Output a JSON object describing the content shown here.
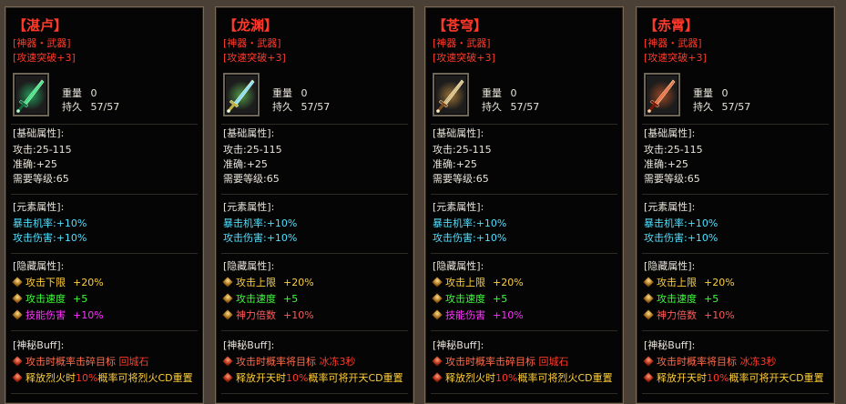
{
  "panels": [
    {
      "name": "湛卢",
      "type_line": "[神器・武器]",
      "effect_line": "[攻速突破+3]",
      "weight_label": "重量",
      "weight_value": "0",
      "durability_label": "持久",
      "durability_value": "57/57",
      "base_title": "[基础属性]:",
      "base_lines": [
        "攻击:25-115",
        "准确:+25",
        "需要等级:65"
      ],
      "elem_title": "[元素属性]:",
      "elem_lines": [
        "暴击机率:+10%",
        "攻击伤害:+10%"
      ],
      "hidden_title": "[隐藏属性]:",
      "hidden": [
        {
          "label": "攻击下限",
          "value": "+20%",
          "label_color": "orange",
          "value_color": "orange"
        },
        {
          "label": "攻击速度",
          "value": "+5",
          "label_color": "green",
          "value_color": "green"
        },
        {
          "label": "技能伤害",
          "value": "+10%",
          "label_color": "magenta",
          "value_color": "magenta"
        }
      ],
      "buff_title": "[神秘Buff]:",
      "buff1": {
        "text": "攻击时概率击碎目标",
        "value": "回城石"
      },
      "buff2": {
        "pre": "释放烈火时",
        "pct": "10%",
        "post": "概率可将烈火CD重置"
      }
    },
    {
      "name": "龙渊",
      "type_line": "[神器・武器]",
      "effect_line": "[攻速突破+3]",
      "weight_label": "重量",
      "weight_value": "0",
      "durability_label": "持久",
      "durability_value": "57/57",
      "base_title": "[基础属性]:",
      "base_lines": [
        "攻击:25-115",
        "准确:+25",
        "需要等级:65"
      ],
      "elem_title": "[元素属性]:",
      "elem_lines": [
        "暴击机率:+10%",
        "攻击伤害:+10%"
      ],
      "hidden_title": "[隐藏属性]:",
      "hidden": [
        {
          "label": "攻击上限",
          "value": "+20%",
          "label_color": "orange",
          "value_color": "orange"
        },
        {
          "label": "攻击速度",
          "value": "+5",
          "label_color": "green",
          "value_color": "green"
        },
        {
          "label": "神力倍数",
          "value": "+10%",
          "label_color": "pink",
          "value_color": "pink"
        }
      ],
      "buff_title": "[神秘Buff]:",
      "buff1": {
        "text": "攻击时概率将目标",
        "value": "冰冻3秒"
      },
      "buff2": {
        "pre": "释放开天时",
        "pct": "10%",
        "post": "概率可将开天CD重置"
      }
    },
    {
      "name": "苍穹",
      "type_line": "[神器・武器]",
      "effect_line": "[攻速突破+3]",
      "weight_label": "重量",
      "weight_value": "0",
      "durability_label": "持久",
      "durability_value": "57/57",
      "base_title": "[基础属性]:",
      "base_lines": [
        "攻击:25-115",
        "准确:+25",
        "需要等级:65"
      ],
      "elem_title": "[元素属性]:",
      "elem_lines": [
        "暴击机率:+10%",
        "攻击伤害:+10%"
      ],
      "hidden_title": "[隐藏属性]:",
      "hidden": [
        {
          "label": "攻击上限",
          "value": "+20%",
          "label_color": "orange",
          "value_color": "orange"
        },
        {
          "label": "攻击速度",
          "value": "+5",
          "label_color": "green",
          "value_color": "green"
        },
        {
          "label": "技能伤害",
          "value": "+10%",
          "label_color": "magenta",
          "value_color": "magenta"
        }
      ],
      "buff_title": "[神秘Buff]:",
      "buff1": {
        "text": "攻击时概率击碎目标",
        "value": "回城石"
      },
      "buff2": {
        "pre": "释放烈火时",
        "pct": "10%",
        "post": "概率可将烈火CD重置"
      }
    },
    {
      "name": "赤霄",
      "type_line": "[神器・武器]",
      "effect_line": "[攻速突破+3]",
      "weight_label": "重量",
      "weight_value": "0",
      "durability_label": "持久",
      "durability_value": "57/57",
      "base_title": "[基础属性]:",
      "base_lines": [
        "攻击:25-115",
        "准确:+25",
        "需要等级:65"
      ],
      "elem_title": "[元素属性]:",
      "elem_lines": [
        "暴击机率:+10%",
        "攻击伤害:+10%"
      ],
      "hidden_title": "[隐藏属性]:",
      "hidden": [
        {
          "label": "攻击上限",
          "value": "+20%",
          "label_color": "orange",
          "value_color": "orange"
        },
        {
          "label": "攻击速度",
          "value": "+5",
          "label_color": "green",
          "value_color": "green"
        },
        {
          "label": "神力倍数",
          "value": "+10%",
          "label_color": "pink",
          "value_color": "pink"
        }
      ],
      "buff_title": "[神秘Buff]:",
      "buff1": {
        "text": "攻击时概率将目标",
        "value": "冰冻3秒"
      },
      "buff2": {
        "pre": "释放开天时",
        "pct": "10%",
        "post": "概率可将开天CD重置"
      }
    }
  ],
  "colors": {
    "title": "#ff3a2b",
    "cyan": "#4fe0ff",
    "orange": "#ffcf3a",
    "green": "#3cff38",
    "magenta": "#ff32ff",
    "pink": "#ff5a5a"
  },
  "icons": [
    "jade-sword-icon",
    "dragon-sword-icon",
    "golden-sword-icon",
    "crimson-sword-icon"
  ]
}
